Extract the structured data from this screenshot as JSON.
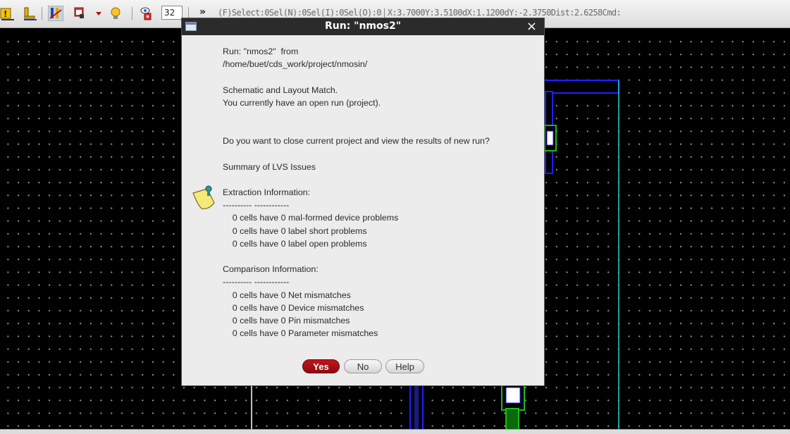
{
  "toolbar": {
    "zoom_value": "32",
    "more_label": "»",
    "status_select": "(F)Select:0Sel(N):0Sel(I):0Sel(O):0",
    "status_coords": "X:3.7000Y:3.5100dX:1.1200dY:-2.3750Dist:2.6258Cmd:"
  },
  "dialog": {
    "title": "Run: \"nmos2\"",
    "close_label": "×",
    "message_lines": [
      "Run: \"nmos2\"  from",
      "/home/buet/cds_work/project/nmosin/",
      "",
      "Schematic and Layout Match.",
      "You currently have an open run (project).",
      "",
      "",
      "Do you want to close current project and view the results of new run?",
      "",
      "Summary of LVS Issues",
      "",
      "Extraction Information:",
      "---------- ------------",
      "    0 cells have 0 mal-formed device problems",
      "    0 cells have 0 label short problems",
      "    0 cells have 0 label open problems",
      "",
      "Comparison Information:",
      "---------- ------------",
      "    0 cells have 0 Net mismatches",
      "    0 cells have 0 Device mismatches",
      "    0 cells have 0 Pin mismatches",
      "    0 cells have 0 Parameter mismatches"
    ],
    "buttons": {
      "yes": "Yes",
      "no": "No",
      "help": "Help"
    }
  },
  "icons": [
    "warning-icon",
    "layer-icon",
    "ruler-icon",
    "window-icon",
    "dropdown-icon",
    "bulb-icon",
    "visibility-icon",
    "note-icon",
    "close-icon"
  ],
  "colors": {
    "canvas": "#000000",
    "grid_dot": "#9a9a9a",
    "layout_blue": "#1a1aff",
    "layout_cyan": "#2fd0d0",
    "layout_green": "#1fb81f",
    "yes_button": "#b2141a"
  }
}
